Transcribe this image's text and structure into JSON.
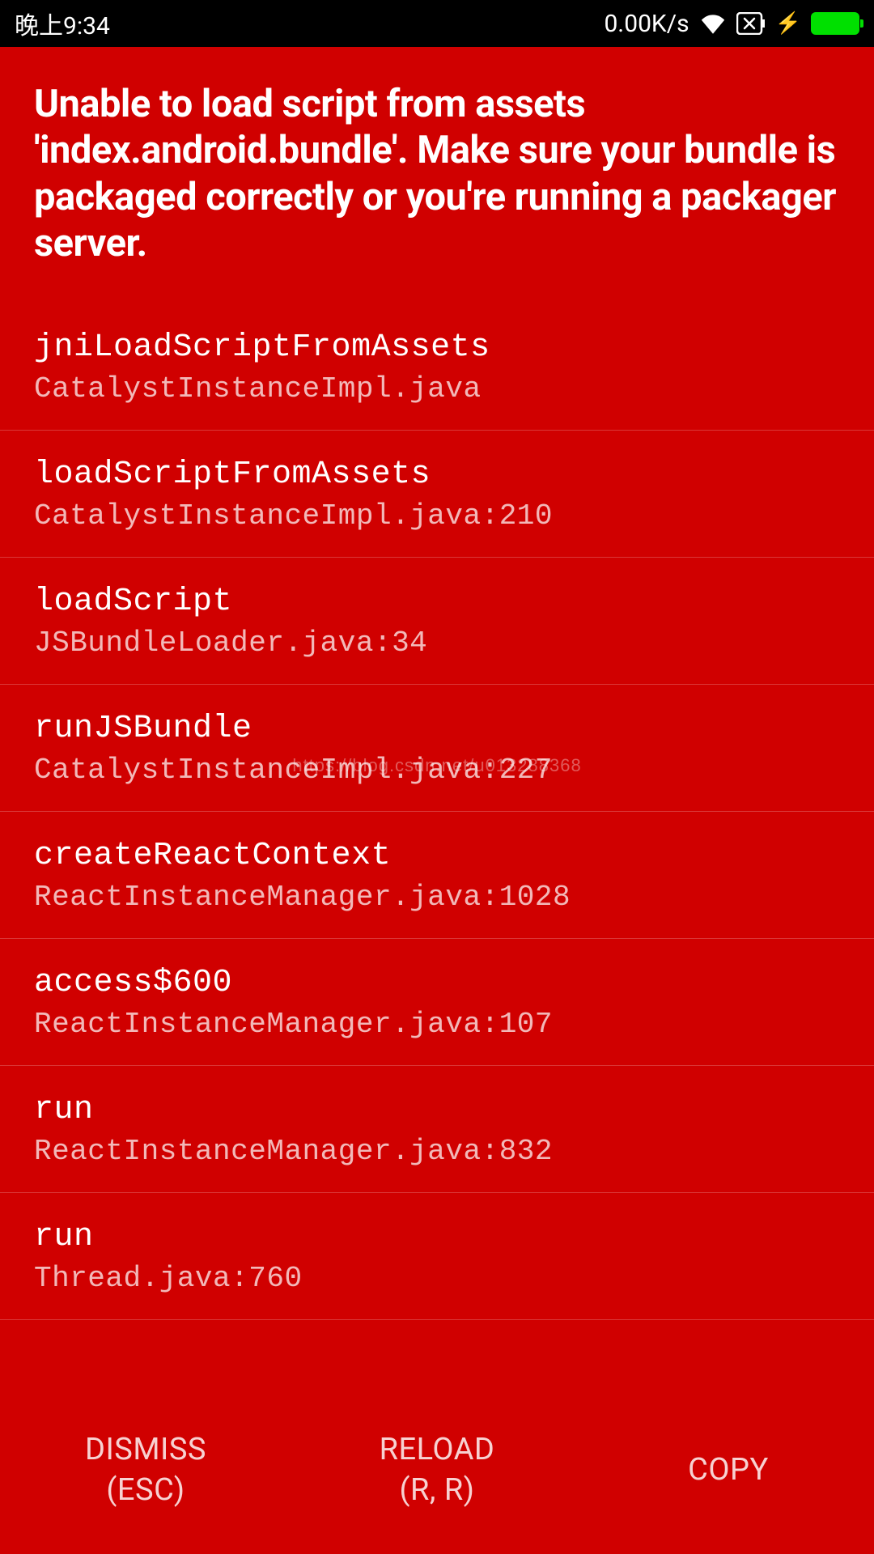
{
  "status_bar": {
    "time": "晚上9:34",
    "network_speed": "0.00K/s"
  },
  "error": {
    "title": "Unable to load script from assets 'index.android.bundle'. Make sure your bundle is packaged correctly or you're running a packager server."
  },
  "stack_trace": [
    {
      "method": "jniLoadScriptFromAssets",
      "location": "CatalystInstanceImpl.java"
    },
    {
      "method": "loadScriptFromAssets",
      "location": "CatalystInstanceImpl.java:210"
    },
    {
      "method": "loadScript",
      "location": "JSBundleLoader.java:34"
    },
    {
      "method": "runJSBundle",
      "location": "CatalystInstanceImpl.java:227"
    },
    {
      "method": "createReactContext",
      "location": "ReactInstanceManager.java:1028"
    },
    {
      "method": "access$600",
      "location": "ReactInstanceManager.java:107"
    },
    {
      "method": "run",
      "location": "ReactInstanceManager.java:832"
    },
    {
      "method": "run",
      "location": "Thread.java:760"
    }
  ],
  "buttons": {
    "dismiss": {
      "label": "DISMISS",
      "shortcut": "(ESC)"
    },
    "reload": {
      "label": "RELOAD",
      "shortcut": "(R, R)"
    },
    "copy": {
      "label": "COPY",
      "shortcut": ""
    }
  },
  "watermark": "https://blog.csdn.net/u013288368"
}
